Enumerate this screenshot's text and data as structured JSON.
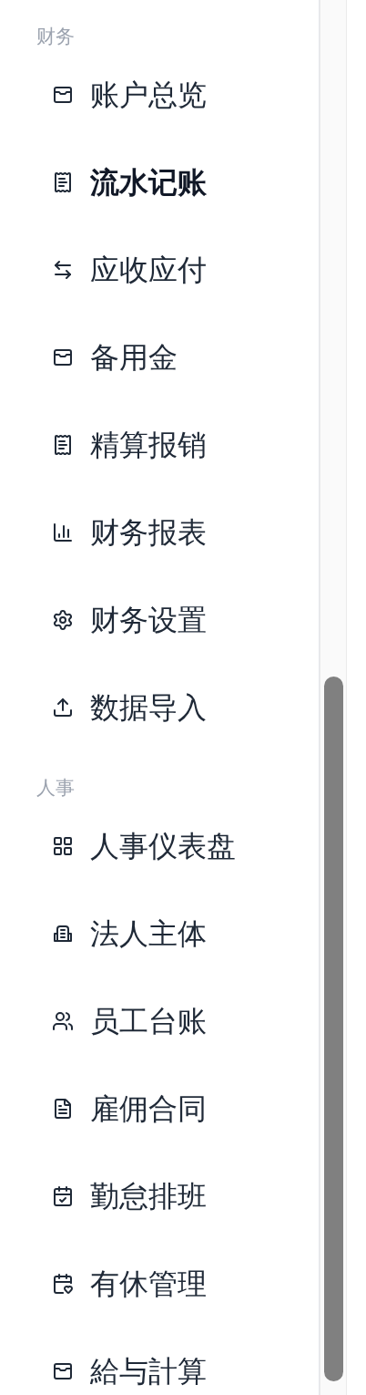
{
  "sidebar": {
    "sections": [
      {
        "heading": "财务",
        "items": [
          {
            "label": "账户总览",
            "kind": "wallet",
            "selected": false
          },
          {
            "label": "流水记账",
            "kind": "receipt",
            "selected": true
          },
          {
            "label": "应收应付",
            "kind": "arrows",
            "selected": false
          },
          {
            "label": "备用金",
            "kind": "wallet",
            "selected": false
          },
          {
            "label": "精算报销",
            "kind": "receipt",
            "selected": false
          },
          {
            "label": "财务报表",
            "kind": "chart",
            "selected": false
          },
          {
            "label": "财务设置",
            "kind": "settings",
            "selected": false
          },
          {
            "label": "数据导入",
            "kind": "upload",
            "selected": false
          }
        ]
      },
      {
        "heading": "人事",
        "items": [
          {
            "label": "人事仪表盘",
            "kind": "grid",
            "selected": false
          },
          {
            "label": "法人主体",
            "kind": "building",
            "selected": false
          },
          {
            "label": "员工台账",
            "kind": "users",
            "selected": false
          },
          {
            "label": "雇佣合同",
            "kind": "file",
            "selected": false
          },
          {
            "label": "勤怠排班",
            "kind": "calendar-check",
            "selected": false
          },
          {
            "label": "有休管理",
            "kind": "calendar-heart",
            "selected": false
          },
          {
            "label": "給与計算",
            "kind": "wallet",
            "selected": false
          }
        ]
      }
    ]
  }
}
